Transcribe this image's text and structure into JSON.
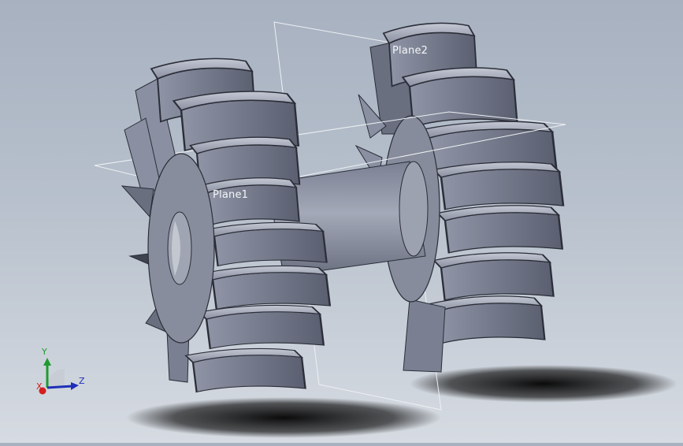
{
  "viewport": {
    "planes": [
      {
        "label": "Plane1"
      },
      {
        "label": "Plane2"
      }
    ]
  },
  "triad": {
    "x_label": "X",
    "y_label": "Y",
    "z_label": "Z",
    "x_color": "#d21f1f",
    "y_color": "#1e9b2e",
    "z_color": "#1f2fb8"
  },
  "model": {
    "face_colors": [
      "#5b6071",
      "#6c7284",
      "#8c92a4",
      "#a9aebd",
      "#cfd3dd"
    ]
  }
}
